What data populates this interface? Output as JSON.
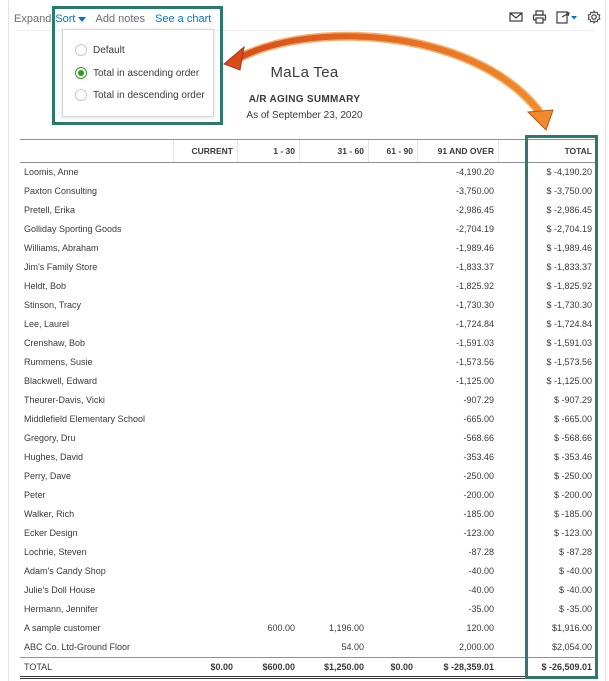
{
  "toolbar": {
    "expand_label": "Expand",
    "sort_label": "Sort",
    "add_notes_label": "Add notes",
    "see_chart_label": "See a chart"
  },
  "icons": [
    "email-icon",
    "print-icon",
    "export-icon",
    "settings-gear-icon"
  ],
  "sort_menu": {
    "options": [
      {
        "label": "Default",
        "selected": false
      },
      {
        "label": "Total in ascending order",
        "selected": true
      },
      {
        "label": "Total in descending order",
        "selected": false
      }
    ]
  },
  "report": {
    "company": "MaLa Tea",
    "title": "A/R AGING SUMMARY",
    "date": "As of September 23, 2020"
  },
  "columns": [
    "CURRENT",
    "1 - 30",
    "31 - 60",
    "61 - 90",
    "91 AND OVER",
    "TOTAL"
  ],
  "rows": [
    {
      "name": "Loomis, Anne",
      "current": "",
      "d1_30": "",
      "d31_60": "",
      "d61_90": "",
      "d91": "-4,190.20",
      "total": "$ -4,190.20"
    },
    {
      "name": "Paxton Consulting",
      "current": "",
      "d1_30": "",
      "d31_60": "",
      "d61_90": "",
      "d91": "-3,750.00",
      "total": "$ -3,750.00"
    },
    {
      "name": "Pretell, Erika",
      "current": "",
      "d1_30": "",
      "d31_60": "",
      "d61_90": "",
      "d91": "-2,986.45",
      "total": "$ -2,986.45"
    },
    {
      "name": "Golliday Sporting Goods",
      "current": "",
      "d1_30": "",
      "d31_60": "",
      "d61_90": "",
      "d91": "-2,704.19",
      "total": "$ -2,704.19"
    },
    {
      "name": "Williams, Abraham",
      "current": "",
      "d1_30": "",
      "d31_60": "",
      "d61_90": "",
      "d91": "-1,989.46",
      "total": "$ -1,989.46"
    },
    {
      "name": "Jim's Family Store",
      "current": "",
      "d1_30": "",
      "d31_60": "",
      "d61_90": "",
      "d91": "-1,833.37",
      "total": "$ -1,833.37"
    },
    {
      "name": "Heldt, Bob",
      "current": "",
      "d1_30": "",
      "d31_60": "",
      "d61_90": "",
      "d91": "-1,825.92",
      "total": "$ -1,825.92"
    },
    {
      "name": "Stinson, Tracy",
      "current": "",
      "d1_30": "",
      "d31_60": "",
      "d61_90": "",
      "d91": "-1,730.30",
      "total": "$ -1,730.30"
    },
    {
      "name": "Lee, Laurel",
      "current": "",
      "d1_30": "",
      "d31_60": "",
      "d61_90": "",
      "d91": "-1,724.84",
      "total": "$ -1,724.84"
    },
    {
      "name": "Crenshaw, Bob",
      "current": "",
      "d1_30": "",
      "d31_60": "",
      "d61_90": "",
      "d91": "-1,591.03",
      "total": "$ -1,591.03"
    },
    {
      "name": "Rummens, Susie",
      "current": "",
      "d1_30": "",
      "d31_60": "",
      "d61_90": "",
      "d91": "-1,573.56",
      "total": "$ -1,573.56"
    },
    {
      "name": "Blackwell, Edward",
      "current": "",
      "d1_30": "",
      "d31_60": "",
      "d61_90": "",
      "d91": "-1,125.00",
      "total": "$ -1,125.00"
    },
    {
      "name": "Theurer-Davis, Vicki",
      "current": "",
      "d1_30": "",
      "d31_60": "",
      "d61_90": "",
      "d91": "-907.29",
      "total": "$ -907.29"
    },
    {
      "name": "Middlefield Elementary School",
      "current": "",
      "d1_30": "",
      "d31_60": "",
      "d61_90": "",
      "d91": "-665.00",
      "total": "$ -665.00"
    },
    {
      "name": "Gregory, Dru",
      "current": "",
      "d1_30": "",
      "d31_60": "",
      "d61_90": "",
      "d91": "-568.66",
      "total": "$ -568.66"
    },
    {
      "name": "Hughes, David",
      "current": "",
      "d1_30": "",
      "d31_60": "",
      "d61_90": "",
      "d91": "-353.46",
      "total": "$ -353.46"
    },
    {
      "name": "Perry, Dave",
      "current": "",
      "d1_30": "",
      "d31_60": "",
      "d61_90": "",
      "d91": "-250.00",
      "total": "$ -250.00"
    },
    {
      "name": "Peter",
      "current": "",
      "d1_30": "",
      "d31_60": "",
      "d61_90": "",
      "d91": "-200.00",
      "total": "$ -200.00"
    },
    {
      "name": "Walker, Rich",
      "current": "",
      "d1_30": "",
      "d31_60": "",
      "d61_90": "",
      "d91": "-185.00",
      "total": "$ -185.00"
    },
    {
      "name": "Ecker Design",
      "current": "",
      "d1_30": "",
      "d31_60": "",
      "d61_90": "",
      "d91": "-123.00",
      "total": "$ -123.00"
    },
    {
      "name": "Lochrie, Steven",
      "current": "",
      "d1_30": "",
      "d31_60": "",
      "d61_90": "",
      "d91": "-87.28",
      "total": "$ -87.28"
    },
    {
      "name": "Adam's Candy Shop",
      "current": "",
      "d1_30": "",
      "d31_60": "",
      "d61_90": "",
      "d91": "-40.00",
      "total": "$ -40.00"
    },
    {
      "name": "Julie's Doll House",
      "current": "",
      "d1_30": "",
      "d31_60": "",
      "d61_90": "",
      "d91": "-40.00",
      "total": "$ -40.00"
    },
    {
      "name": "Hermann, Jennifer",
      "current": "",
      "d1_30": "",
      "d31_60": "",
      "d61_90": "",
      "d91": "-35.00",
      "total": "$ -35.00"
    },
    {
      "name": "A sample customer",
      "current": "",
      "d1_30": "600.00",
      "d31_60": "1,196.00",
      "d61_90": "",
      "d91": "120.00",
      "total": "$1,916.00"
    },
    {
      "name": "ABC Co. Ltd-Ground Floor",
      "current": "",
      "d1_30": "",
      "d31_60": "54.00",
      "d61_90": "",
      "d91": "2,000.00",
      "total": "$2,054.00"
    }
  ],
  "totals": {
    "name": "TOTAL",
    "current": "$0.00",
    "d1_30": "$600.00",
    "d31_60": "$1,250.00",
    "d61_90": "$0.00",
    "d91": "$ -28,359.01",
    "total": "$ -26,509.01"
  },
  "colors": {
    "highlight": "#2b7a6a",
    "arrow": "#e8711f",
    "link": "#0077c5",
    "radio_selected": "#2ca01c"
  }
}
